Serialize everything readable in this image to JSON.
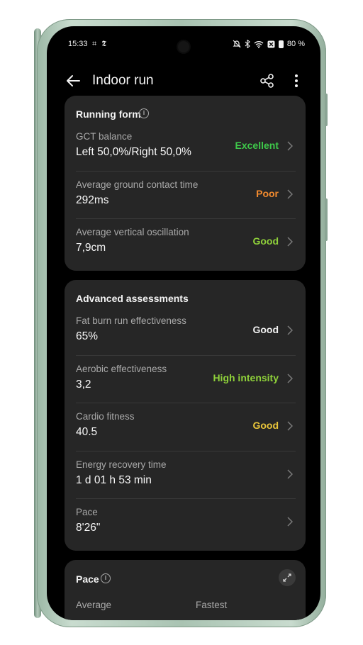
{
  "status": {
    "time": "15:33",
    "notif_icons": "⌗ 𝕿",
    "battery": "80 %"
  },
  "header": {
    "title": "Indoor run"
  },
  "running_form": {
    "title": "Running form",
    "rows": [
      {
        "label": "GCT balance",
        "value": "Left 50,0%/Right 50,0%",
        "rating": "Excellent",
        "rating_color": "#3ec94a"
      },
      {
        "label": "Average ground contact time",
        "value": "292ms",
        "rating": "Poor",
        "rating_color": "#f28a2e"
      },
      {
        "label": "Average vertical oscillation",
        "value": "7,9cm",
        "rating": "Good",
        "rating_color": "#8fd13a"
      }
    ]
  },
  "advanced": {
    "title": "Advanced assessments",
    "rows": [
      {
        "label": "Fat burn run effectiveness",
        "value": "65%",
        "rating": "Good",
        "rating_color": "#f0f0f0"
      },
      {
        "label": "Aerobic effectiveness",
        "value": "3,2",
        "rating": "High intensity",
        "rating_color": "#8fd13a"
      },
      {
        "label": "Cardio fitness",
        "value": "40.5",
        "rating": "Good",
        "rating_color": "#e9c53a"
      },
      {
        "label": "Energy recovery time",
        "value": "1 d 01 h 53 min",
        "rating": "",
        "rating_color": "#f0f0f0"
      },
      {
        "label": "Pace",
        "value": "8'26\"",
        "rating": "",
        "rating_color": "#f0f0f0"
      }
    ]
  },
  "pace": {
    "title": "Pace",
    "col_average": "Average",
    "col_fastest": "Fastest"
  }
}
